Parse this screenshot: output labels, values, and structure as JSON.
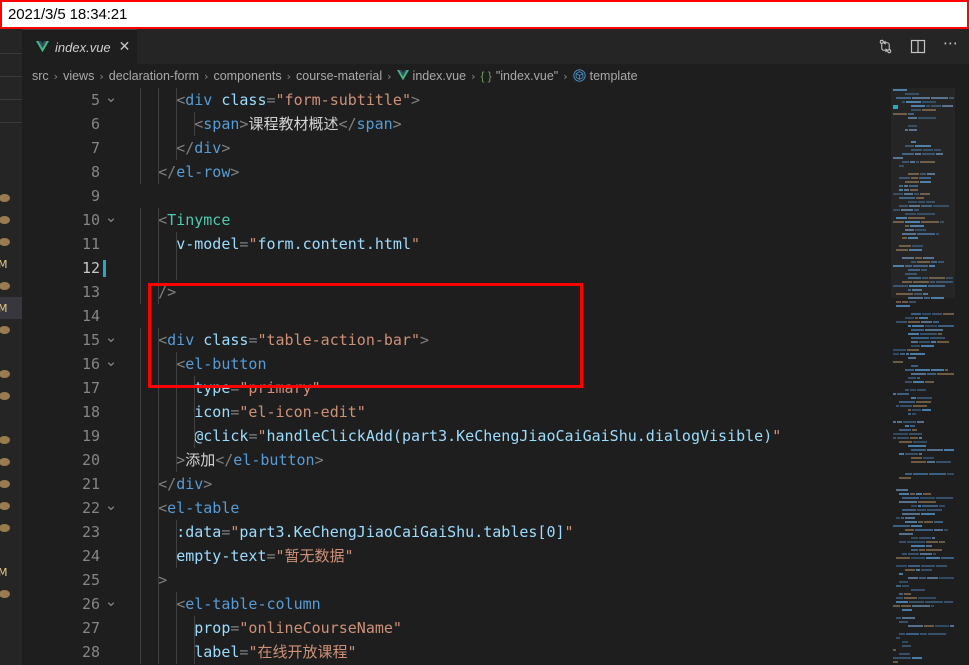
{
  "timestamp": {
    "text": "2021/3/5 18:34:21",
    "border_color": "#ff0000",
    "bg": "#ffffff",
    "fg": "#000000"
  },
  "tab": {
    "label": "index.vue",
    "icon": "vue-logo-icon",
    "close_label": "✕"
  },
  "tab_actions": {
    "split_compare_label": "source-control-icon",
    "split_editor_label": "split-editor-icon",
    "more_label": "⋯"
  },
  "breadcrumb": {
    "items": [
      {
        "label": "src",
        "icon": null
      },
      {
        "label": "views",
        "icon": null
      },
      {
        "label": "declaration-form",
        "icon": null
      },
      {
        "label": "components",
        "icon": null
      },
      {
        "label": "course-material",
        "icon": null
      },
      {
        "label": "index.vue",
        "icon": "vue-logo-icon"
      },
      {
        "label": "\"index.vue\"",
        "icon": "braces-icon",
        "braces": "{ }"
      },
      {
        "label": "template",
        "icon": "symbol-cube-icon"
      }
    ],
    "separator": "›"
  },
  "explorer": {
    "rows": [
      {
        "icon": "file-icon",
        "selected": false
      },
      {
        "icon": "file-icon",
        "selected": false
      },
      {
        "icon": "file-icon",
        "selected": false
      },
      {
        "icon": "markdown-icon",
        "selected": false
      },
      {
        "icon": "file-icon",
        "selected": false
      },
      {
        "icon": "markdown-icon",
        "selected": true
      },
      {
        "icon": "file-icon",
        "selected": false
      },
      {
        "icon": null,
        "selected": false
      },
      {
        "icon": "file-icon",
        "selected": false
      },
      {
        "icon": "file-icon",
        "selected": false
      },
      {
        "icon": null,
        "selected": false
      },
      {
        "icon": "file-icon",
        "selected": false
      },
      {
        "icon": "file-icon",
        "selected": false
      },
      {
        "icon": "file-icon",
        "selected": false
      },
      {
        "icon": "file-icon",
        "selected": false
      },
      {
        "icon": "file-icon",
        "selected": false
      },
      {
        "icon": null,
        "selected": false
      },
      {
        "icon": "markdown-icon",
        "selected": false
      },
      {
        "icon": "file-icon",
        "selected": false
      }
    ]
  },
  "editor": {
    "cursor_line": 12,
    "first_line": 5,
    "language": "vue",
    "lines": [
      {
        "n": 5,
        "fold": "open",
        "indent": 3,
        "tokens": [
          {
            "t": "punc",
            "v": "      "
          },
          {
            "t": "punc",
            "v": "<"
          },
          {
            "t": "tag",
            "v": "div"
          },
          {
            "t": "txt",
            "v": " "
          },
          {
            "t": "attr",
            "v": "class"
          },
          {
            "t": "punc",
            "v": "="
          },
          {
            "t": "str",
            "v": "\"form-subtitle\""
          },
          {
            "t": "punc",
            "v": ">"
          }
        ]
      },
      {
        "n": 6,
        "fold": null,
        "indent": 4,
        "tokens": [
          {
            "t": "punc",
            "v": "        "
          },
          {
            "t": "punc",
            "v": "<"
          },
          {
            "t": "tag",
            "v": "span"
          },
          {
            "t": "punc",
            "v": ">"
          },
          {
            "t": "txt",
            "v": "课程教材概述"
          },
          {
            "t": "punc",
            "v": "</"
          },
          {
            "t": "tag",
            "v": "span"
          },
          {
            "t": "punc",
            "v": ">"
          }
        ]
      },
      {
        "n": 7,
        "fold": null,
        "indent": 3,
        "tokens": [
          {
            "t": "punc",
            "v": "      </"
          },
          {
            "t": "tag",
            "v": "div"
          },
          {
            "t": "punc",
            "v": ">"
          }
        ]
      },
      {
        "n": 8,
        "fold": null,
        "indent": 2,
        "tokens": [
          {
            "t": "punc",
            "v": "    </"
          },
          {
            "t": "tag",
            "v": "el-row"
          },
          {
            "t": "punc",
            "v": ">"
          }
        ]
      },
      {
        "n": 9,
        "fold": null,
        "indent": 0,
        "tokens": []
      },
      {
        "n": 10,
        "fold": "open",
        "indent": 2,
        "tokens": [
          {
            "t": "punc",
            "v": "    "
          },
          {
            "t": "punc",
            "v": "<"
          },
          {
            "t": "comp",
            "v": "Tinymce"
          }
        ]
      },
      {
        "n": 11,
        "fold": null,
        "indent": 3,
        "tokens": [
          {
            "t": "punc",
            "v": "      "
          },
          {
            "t": "attr",
            "v": "v-model"
          },
          {
            "t": "punc",
            "v": "="
          },
          {
            "t": "str",
            "v": "\""
          },
          {
            "t": "attr",
            "v": "form.content.html"
          },
          {
            "t": "str",
            "v": "\""
          }
        ]
      },
      {
        "n": 12,
        "fold": null,
        "indent": 3,
        "tokens": []
      },
      {
        "n": 13,
        "fold": null,
        "indent": 2,
        "tokens": [
          {
            "t": "punc",
            "v": "    "
          },
          {
            "t": "slash",
            "v": "/>"
          }
        ]
      },
      {
        "n": 14,
        "fold": null,
        "indent": 0,
        "tokens": []
      },
      {
        "n": 15,
        "fold": "open",
        "indent": 2,
        "tokens": [
          {
            "t": "punc",
            "v": "    "
          },
          {
            "t": "punc",
            "v": "<"
          },
          {
            "t": "tag",
            "v": "div"
          },
          {
            "t": "txt",
            "v": " "
          },
          {
            "t": "attr",
            "v": "class"
          },
          {
            "t": "punc",
            "v": "="
          },
          {
            "t": "str",
            "v": "\"table-action-bar\""
          },
          {
            "t": "punc",
            "v": ">"
          }
        ]
      },
      {
        "n": 16,
        "fold": "open",
        "indent": 3,
        "tokens": [
          {
            "t": "punc",
            "v": "      "
          },
          {
            "t": "punc",
            "v": "<"
          },
          {
            "t": "tag",
            "v": "el-button"
          }
        ]
      },
      {
        "n": 17,
        "fold": null,
        "indent": 4,
        "tokens": [
          {
            "t": "punc",
            "v": "        "
          },
          {
            "t": "attr",
            "v": "type"
          },
          {
            "t": "punc",
            "v": "="
          },
          {
            "t": "str",
            "v": "\"primary\""
          }
        ]
      },
      {
        "n": 18,
        "fold": null,
        "indent": 4,
        "tokens": [
          {
            "t": "punc",
            "v": "        "
          },
          {
            "t": "attr",
            "v": "icon"
          },
          {
            "t": "punc",
            "v": "="
          },
          {
            "t": "str",
            "v": "\"el-icon-edit\""
          }
        ]
      },
      {
        "n": 19,
        "fold": null,
        "indent": 4,
        "tokens": [
          {
            "t": "punc",
            "v": "        "
          },
          {
            "t": "attr",
            "v": "@click"
          },
          {
            "t": "punc",
            "v": "="
          },
          {
            "t": "str",
            "v": "\""
          },
          {
            "t": "attr",
            "v": "handleClickAdd(part3.KeChengJiaoCaiGaiShu.dialogVisible)"
          },
          {
            "t": "str",
            "v": "\""
          }
        ]
      },
      {
        "n": 20,
        "fold": null,
        "indent": 3,
        "tokens": [
          {
            "t": "punc",
            "v": "      >"
          },
          {
            "t": "txt",
            "v": "添加"
          },
          {
            "t": "punc",
            "v": "</"
          },
          {
            "t": "tag",
            "v": "el-button"
          },
          {
            "t": "punc",
            "v": ">"
          }
        ]
      },
      {
        "n": 21,
        "fold": null,
        "indent": 2,
        "tokens": [
          {
            "t": "punc",
            "v": "    </"
          },
          {
            "t": "tag",
            "v": "div"
          },
          {
            "t": "punc",
            "v": ">"
          }
        ]
      },
      {
        "n": 22,
        "fold": "open",
        "indent": 2,
        "tokens": [
          {
            "t": "punc",
            "v": "    "
          },
          {
            "t": "punc",
            "v": "<"
          },
          {
            "t": "tag",
            "v": "el-table"
          }
        ]
      },
      {
        "n": 23,
        "fold": null,
        "indent": 3,
        "tokens": [
          {
            "t": "punc",
            "v": "      "
          },
          {
            "t": "attr",
            "v": ":data"
          },
          {
            "t": "punc",
            "v": "="
          },
          {
            "t": "str",
            "v": "\""
          },
          {
            "t": "attr",
            "v": "part3.KeChengJiaoCaiGaiShu.tables[0]"
          },
          {
            "t": "str",
            "v": "\""
          }
        ]
      },
      {
        "n": 24,
        "fold": null,
        "indent": 3,
        "tokens": [
          {
            "t": "punc",
            "v": "      "
          },
          {
            "t": "attr",
            "v": "empty-text"
          },
          {
            "t": "punc",
            "v": "="
          },
          {
            "t": "str",
            "v": "\"暂无数据\""
          }
        ]
      },
      {
        "n": 25,
        "fold": null,
        "indent": 2,
        "tokens": [
          {
            "t": "punc",
            "v": "    >"
          }
        ]
      },
      {
        "n": 26,
        "fold": "open",
        "indent": 3,
        "tokens": [
          {
            "t": "punc",
            "v": "      "
          },
          {
            "t": "punc",
            "v": "<"
          },
          {
            "t": "tag",
            "v": "el-table-column"
          }
        ]
      },
      {
        "n": 27,
        "fold": null,
        "indent": 4,
        "tokens": [
          {
            "t": "punc",
            "v": "        "
          },
          {
            "t": "attr",
            "v": "prop"
          },
          {
            "t": "punc",
            "v": "="
          },
          {
            "t": "str",
            "v": "\"onlineCourseName\""
          }
        ]
      },
      {
        "n": 28,
        "fold": null,
        "indent": 4,
        "tokens": [
          {
            "t": "punc",
            "v": "        "
          },
          {
            "t": "attr",
            "v": "label"
          },
          {
            "t": "punc",
            "v": "="
          },
          {
            "t": "str",
            "v": "\"在线开放课程\""
          }
        ]
      }
    ]
  },
  "annotation": {
    "shape": "rectangle",
    "color": "#ff0000",
    "covers_lines": [
      10,
      11,
      12,
      13
    ]
  },
  "colors": {
    "editor_bg": "#1e1e1e",
    "chrome_bg": "#252526",
    "tag": "#569cd6",
    "component": "#4ec9b0",
    "attribute": "#9cdcfe",
    "string": "#ce9178",
    "punctuation": "#808080",
    "text": "#d4d4d4",
    "line_number": "#858585",
    "cursor": "#2ba6c4",
    "vue_green": "#6fbf73"
  }
}
